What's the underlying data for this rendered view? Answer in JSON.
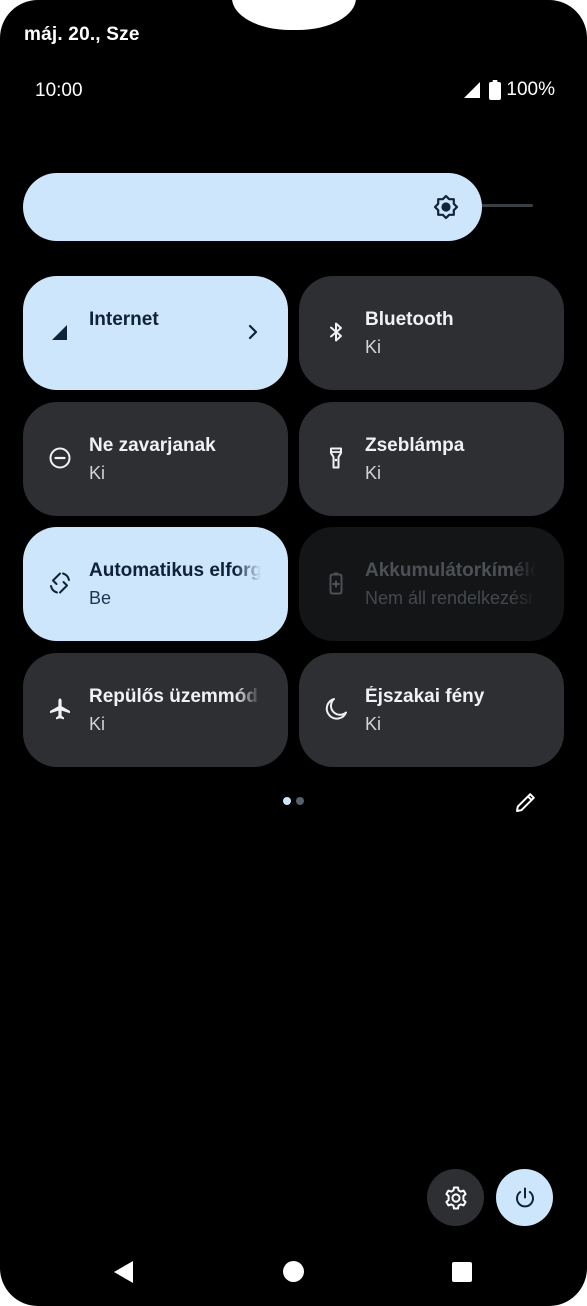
{
  "status_bar": {
    "date": "máj. 20., Sze",
    "time": "10:00",
    "battery": "100%"
  },
  "brightness": {
    "level": 0.86,
    "icon": "brightness-icon"
  },
  "tiles": [
    {
      "id": "internet",
      "label": "Internet",
      "sub": "",
      "state": "active",
      "icon": "cellular-signal-icon",
      "has_chevron": true
    },
    {
      "id": "bluetooth",
      "label": "Bluetooth",
      "sub": "Ki",
      "state": "inactive",
      "icon": "bluetooth-icon"
    },
    {
      "id": "dnd",
      "label": "Ne zavarjanak",
      "sub": "Ki",
      "state": "inactive",
      "icon": "do-not-disturb-icon"
    },
    {
      "id": "flashlight",
      "label": "Zseblámpa",
      "sub": "Ki",
      "state": "inactive",
      "icon": "flashlight-icon"
    },
    {
      "id": "autorotate",
      "label": "Automatikus elforgatás",
      "sub": "Be",
      "state": "active",
      "icon": "auto-rotate-icon"
    },
    {
      "id": "battery-saver",
      "label": "Akkumulátorkímélő",
      "sub": "Nem áll rendelkezésre",
      "state": "disabled",
      "icon": "battery-saver-icon"
    },
    {
      "id": "airplane",
      "label": "Repülős üzemmód",
      "sub": "Ki",
      "state": "inactive",
      "icon": "airplane-icon"
    },
    {
      "id": "night-light",
      "label": "Éjszakai fény",
      "sub": "Ki",
      "state": "inactive",
      "icon": "night-light-icon"
    }
  ],
  "pager": {
    "pages": 2,
    "current": 1
  },
  "colors": {
    "background": "#000000",
    "tile_active": "#cde6fb",
    "tile_inactive": "#2d2f33",
    "tile_disabled": "#141516"
  }
}
